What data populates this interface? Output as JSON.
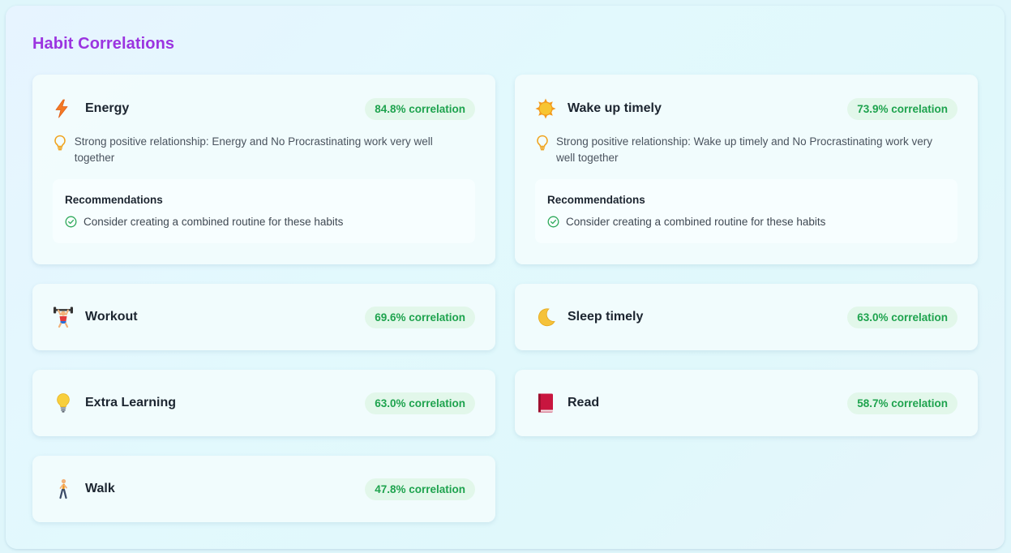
{
  "title": "Habit Correlations",
  "colors": {
    "title": "#9b34e0",
    "badge_text": "#1ea34e",
    "badge_bg": "#e2f7ea",
    "insight_icon": "#f0a21a",
    "check_icon": "#2ea95a"
  },
  "cards": [
    {
      "name": "Energy",
      "icon": "lightning-icon",
      "correlation": "84.8% correlation",
      "insight": "Strong positive relationship: Energy and No Procrastinating work very well together",
      "recommendations_title": "Recommendations",
      "recommendation": "Consider creating a combined routine for these habits"
    },
    {
      "name": "Wake up timely",
      "icon": "sun-icon",
      "correlation": "73.9% correlation",
      "insight": "Strong positive relationship: Wake up timely and No Procrastinating work very well together",
      "recommendations_title": "Recommendations",
      "recommendation": "Consider creating a combined routine for these habits"
    },
    {
      "name": "Workout",
      "icon": "weightlifter-icon",
      "correlation": "69.6% correlation"
    },
    {
      "name": "Sleep timely",
      "icon": "crescent-moon-icon",
      "correlation": "63.0% correlation"
    },
    {
      "name": "Extra Learning",
      "icon": "light-bulb-icon",
      "correlation": "63.0% correlation"
    },
    {
      "name": "Read",
      "icon": "book-icon",
      "correlation": "58.7% correlation"
    },
    {
      "name": "Walk",
      "icon": "walking-person-icon",
      "correlation": "47.8% correlation"
    }
  ]
}
